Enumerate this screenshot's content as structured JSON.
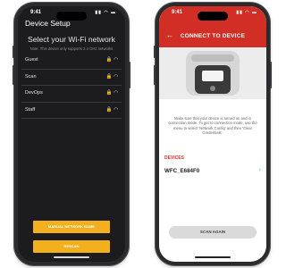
{
  "left_screen": {
    "status": {
      "time": "9:41",
      "icons": "▮▮ ◠ ▬"
    },
    "title": "Device Setup",
    "heading": "Select your Wi-Fi network",
    "note": "Note: This device only supports 2.4 GHz networks",
    "networks": [
      {
        "name": "Guest",
        "icons": "🔒 ◠"
      },
      {
        "name": "Scan",
        "icons": "🔒 ◠"
      },
      {
        "name": "DevOps",
        "icons": "🔒 ◠"
      },
      {
        "name": "Staff",
        "icons": "🔒 ◠"
      }
    ],
    "buttons": {
      "manual": "MANUAL NETWORK NAME",
      "rescan": "RESCAN"
    },
    "accent_color": "#f2b01e"
  },
  "right_screen": {
    "status": {
      "time": "9:41",
      "icons": "▮▮ ◠ ▬"
    },
    "back": "←",
    "title": "CONNECT TO DEVICE",
    "description": "Make sure that your device is turned on and in connection mode. To get to connection mode, use the menu to select 'Network Config' and then 'Clear Credentials'.",
    "devices_label": "DEVICES",
    "device": {
      "name": "WFC_E684F0",
      "chevron": "›"
    },
    "scan_again": "SCAN AGAIN",
    "header_color": "#d12f26"
  }
}
